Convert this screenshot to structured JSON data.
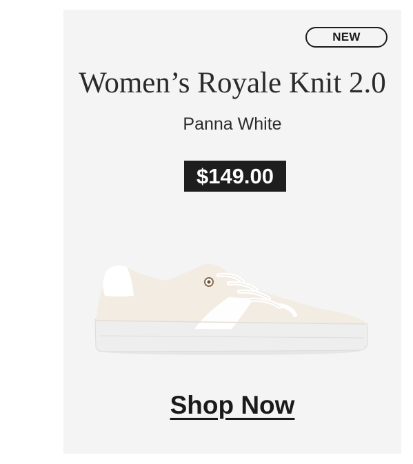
{
  "product": {
    "badge": "NEW",
    "title": "Women’s Royale Knit 2.0",
    "color_name": "Panna White",
    "price": "$149.00",
    "image_icon": "sneaker-image"
  },
  "cta": {
    "label": "Shop Now"
  },
  "colors": {
    "card_background": "#f4f4f4",
    "text": "#2b2b2b",
    "price_background": "#1e1e1e",
    "price_text": "#ffffff",
    "shoe_upper": "#f3ece3",
    "shoe_sole": "#e9e9e9"
  }
}
